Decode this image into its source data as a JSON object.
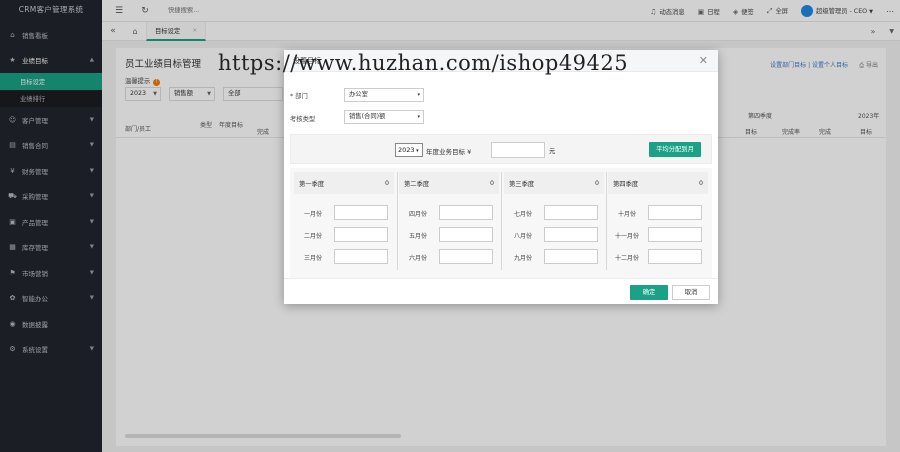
{
  "app": {
    "title": "CRM客户管理系统"
  },
  "sidebar": {
    "items": [
      {
        "label": "销售看板",
        "icon": "house"
      },
      {
        "label": "业绩目标",
        "icon": "star",
        "expanded": true,
        "children": [
          {
            "label": "目标设定",
            "active": true
          },
          {
            "label": "业绩排行"
          }
        ]
      },
      {
        "label": "客户管理",
        "icon": "user"
      },
      {
        "label": "销售合同",
        "icon": "doc"
      },
      {
        "label": "财务管理",
        "icon": "money"
      },
      {
        "label": "采购管理",
        "icon": "cart"
      },
      {
        "label": "产品管理",
        "icon": "box"
      },
      {
        "label": "库存管理",
        "icon": "stack"
      },
      {
        "label": "市场营销",
        "icon": "flag"
      },
      {
        "label": "智能办公",
        "icon": "gear"
      },
      {
        "label": "数据披露",
        "icon": "chart"
      },
      {
        "label": "系统设置",
        "icon": "cog"
      }
    ]
  },
  "topbar": {
    "search_placeholder": "快捷搜索...",
    "messages": "动态消息",
    "calendar": "日程",
    "notes": "便签",
    "fullscreen": "全屏",
    "user": "超级管理员 - CEO"
  },
  "tabs": [
    {
      "label": "目标设定"
    }
  ],
  "page": {
    "title": "员工业绩目标管理",
    "links": "设置部门目标 | 设置个人目标",
    "export": "导出",
    "hint_label": "温馨提示",
    "filters": {
      "year": "2023",
      "type": "销售额",
      "scope": "全部"
    },
    "table_headers": {
      "dept": "部门/员工",
      "type": "类型",
      "year_target": "年度目标",
      "completed": "完成",
      "q4": "第四季度",
      "target": "目标",
      "done": "完成率",
      "completed2": "完成",
      "last": "2023年"
    }
  },
  "modal": {
    "title": "设置目标",
    "dept_label": "部门",
    "dept_value": "办公室",
    "assessment_label": "考核类型",
    "assessment_value": "销售(合同)额",
    "year": "2023",
    "goal_text": "年度业务目标 ¥",
    "goal_unit": "元",
    "distribute_btn": "平均分配到月",
    "quarters": [
      {
        "name": "第一季度",
        "value": "0",
        "months": [
          "一月份",
          "二月份",
          "三月份"
        ]
      },
      {
        "name": "第二季度",
        "value": "0",
        "months": [
          "四月份",
          "五月份",
          "六月份"
        ]
      },
      {
        "name": "第三季度",
        "value": "0",
        "months": [
          "七月份",
          "八月份",
          "九月份"
        ]
      },
      {
        "name": "第四季度",
        "value": "0",
        "months": [
          "十月份",
          "十一月份",
          "十二月份"
        ]
      }
    ],
    "confirm": "确定",
    "cancel": "取消"
  },
  "watermark": "https://www.huzhan.com/ishop49425"
}
